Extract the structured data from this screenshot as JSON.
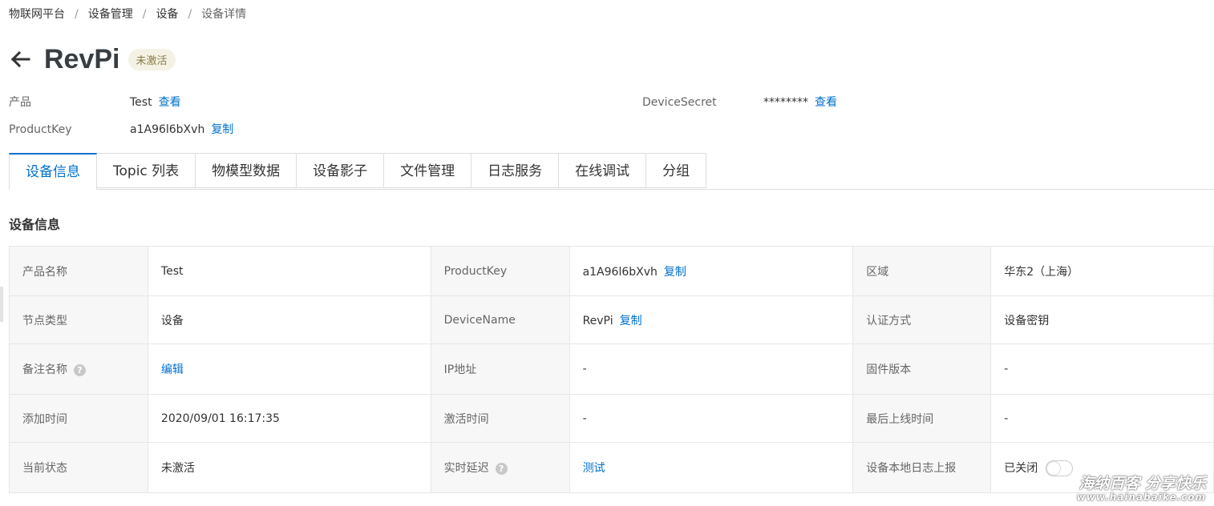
{
  "breadcrumb": [
    "物联网平台",
    "设备管理",
    "设备",
    "设备详情"
  ],
  "breadcrumb_sep": "/",
  "device": {
    "name": "RevPi",
    "status_badge": "未激活"
  },
  "meta": {
    "product_label": "产品",
    "product_value": "Test",
    "product_link": "查看",
    "productkey_label": "ProductKey",
    "productkey_value": "a1A96l6bXvh",
    "productkey_link": "复制",
    "secret_label": "DeviceSecret",
    "secret_value": "********",
    "secret_link": "查看"
  },
  "tabs": [
    "设备信息",
    "Topic 列表",
    "物模型数据",
    "设备影子",
    "文件管理",
    "日志服务",
    "在线调试",
    "分组"
  ],
  "active_tab": "设备信息",
  "section_title": "设备信息",
  "rows": [
    {
      "c1_label": "产品名称",
      "c1_value": "Test",
      "c2_label": "ProductKey",
      "c2_value": "a1A96l6bXvh",
      "c2_link": "复制",
      "c3_label": "区域",
      "c3_value": "华东2（上海）"
    },
    {
      "c1_label": "节点类型",
      "c1_value": "设备",
      "c2_label": "DeviceName",
      "c2_value": "RevPi",
      "c2_link": "复制",
      "c3_label": "认证方式",
      "c3_value": "设备密钥"
    },
    {
      "c1_label": "备注名称",
      "c1_link": "编辑",
      "c2_label": "IP地址",
      "c2_value": "-",
      "c3_label": "固件版本",
      "c3_value": "-"
    },
    {
      "c1_label": "添加时间",
      "c1_value": "2020/09/01 16:17:35",
      "c2_label": "激活时间",
      "c2_value": "-",
      "c3_label": "最后上线时间",
      "c3_value": "-"
    },
    {
      "c1_label": "当前状态",
      "c1_value": "未激活",
      "c2_label": "实时延迟",
      "c2_link": "测试",
      "c3_label": "设备本地日志上报",
      "c3_value": "已关闭",
      "c3_toggle": false
    }
  ],
  "help_icon_glyph": "?",
  "colors": {
    "link": "#0070cc",
    "badge_bg": "#f4f2e4",
    "badge_text": "#8b7a45",
    "label_bg": "#f7f7f7"
  },
  "watermark": {
    "line1": "海纳百客 分享快乐",
    "line2": "www.hainabaike.com"
  }
}
